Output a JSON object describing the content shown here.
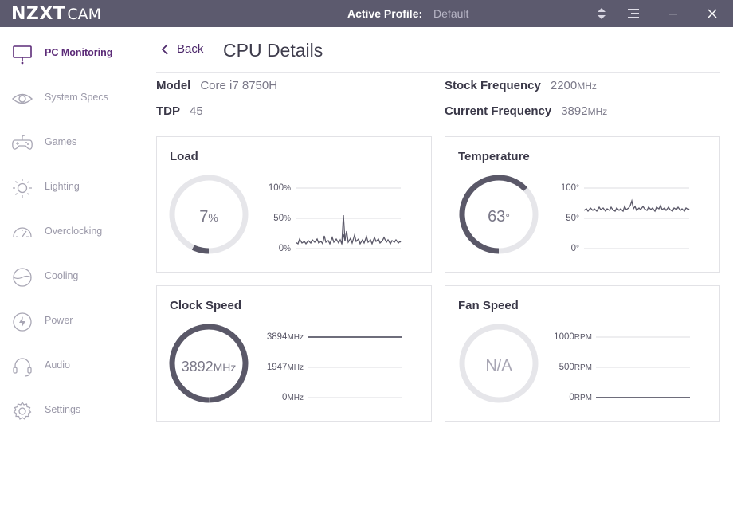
{
  "titlebar": {
    "brand": "NZXT",
    "app": "CAM",
    "profile_label": "Active Profile:",
    "profile_value": "Default"
  },
  "sidebar": {
    "items": [
      {
        "label": "PC Monitoring",
        "icon": "monitor-icon",
        "active": true
      },
      {
        "label": "System Specs",
        "icon": "eye-icon",
        "active": false
      },
      {
        "label": "Games",
        "icon": "gamepad-icon",
        "active": false
      },
      {
        "label": "Lighting",
        "icon": "sun-icon",
        "active": false
      },
      {
        "label": "Overclocking",
        "icon": "speedometer-icon",
        "active": false
      },
      {
        "label": "Cooling",
        "icon": "cooling-icon",
        "active": false
      },
      {
        "label": "Power",
        "icon": "lightning-icon",
        "active": false
      },
      {
        "label": "Audio",
        "icon": "headset-icon",
        "active": false
      },
      {
        "label": "Settings",
        "icon": "gear-icon",
        "active": false
      }
    ]
  },
  "header": {
    "back_label": "Back",
    "title": "CPU Details"
  },
  "info": {
    "model_label": "Model",
    "model_value": "Core i7 8750H",
    "tdp_label": "TDP",
    "tdp_value": "45",
    "stock_label": "Stock Frequency",
    "stock_value": "2200",
    "stock_unit": "MHz",
    "current_label": "Current Frequency",
    "current_value": "3892",
    "current_unit": "MHz"
  },
  "cards": {
    "load": {
      "title": "Load",
      "value": "7",
      "unit": "%",
      "fraction": 0.07,
      "ticks": [
        "100",
        "50",
        "0"
      ],
      "tick_unit": "%"
    },
    "temperature": {
      "title": "Temperature",
      "value": "63",
      "unit": "°",
      "fraction": 0.63,
      "ticks": [
        "100",
        "50",
        "0"
      ],
      "tick_unit": "°"
    },
    "clock": {
      "title": "Clock Speed",
      "value": "3892",
      "unit": "MHz",
      "fraction": 0.999,
      "ticks": [
        "3894",
        "1947",
        "0"
      ],
      "tick_unit": "MHz"
    },
    "fan": {
      "title": "Fan Speed",
      "value": "N/A",
      "unit": "",
      "fraction": 0,
      "ticks": [
        "1000",
        "500",
        "0"
      ],
      "tick_unit": "RPM"
    }
  },
  "colors": {
    "titlebar": "#5c5a6e",
    "accent": "#5c2b78",
    "gauge_fill": "#5a5868",
    "gauge_track": "#e6e6ea"
  }
}
